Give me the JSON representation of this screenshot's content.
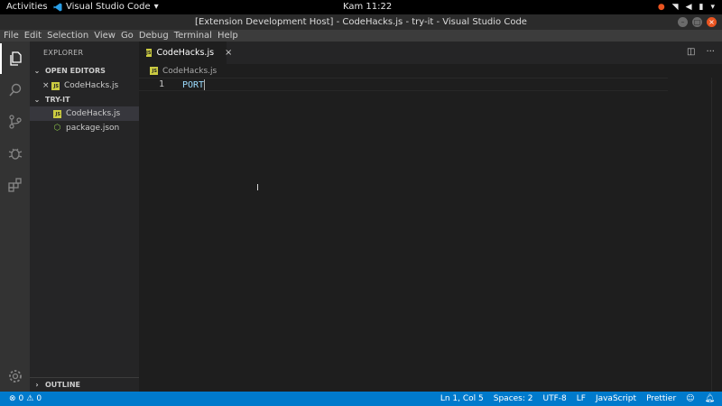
{
  "topbar": {
    "activities": "Activities",
    "app_name": "Visual Studio Code",
    "clock": "Kam 11:22"
  },
  "window": {
    "title": "[Extension Development Host] - CodeHacks.js - try-it - Visual Studio Code"
  },
  "menu": [
    "File",
    "Edit",
    "Selection",
    "View",
    "Go",
    "Debug",
    "Terminal",
    "Help"
  ],
  "activity_bar": [
    "files-icon",
    "search-icon",
    "source-control-icon",
    "debug-icon",
    "extensions-icon",
    "settings-gear-icon"
  ],
  "sidebar": {
    "title": "EXPLORER",
    "open_editors_label": "OPEN EDITORS",
    "open_editors": [
      {
        "name": "CodeHacks.js",
        "icon": "js-file-icon"
      }
    ],
    "workspace_label": "TRY-IT",
    "files": [
      {
        "name": "CodeHacks.js",
        "icon": "js-file-icon",
        "selected": true
      },
      {
        "name": "package.json",
        "icon": "json-file-icon",
        "selected": false
      }
    ],
    "outline_label": "OUTLINE"
  },
  "editor": {
    "tab_label": "CodeHacks.js",
    "breadcrumb": "CodeHacks.js",
    "lines": [
      {
        "number": "1",
        "text": "PORT"
      }
    ]
  },
  "statusbar": {
    "errors": "0",
    "warnings": "0",
    "position": "Ln 1, Col 5",
    "spaces": "Spaces: 2",
    "encoding": "UTF-8",
    "eol": "LF",
    "language": "JavaScript",
    "formatter": "Prettier"
  },
  "colors": {
    "accent": "#007acc",
    "js_icon": "#cbcb41",
    "code_text": "#9cdcfe"
  }
}
